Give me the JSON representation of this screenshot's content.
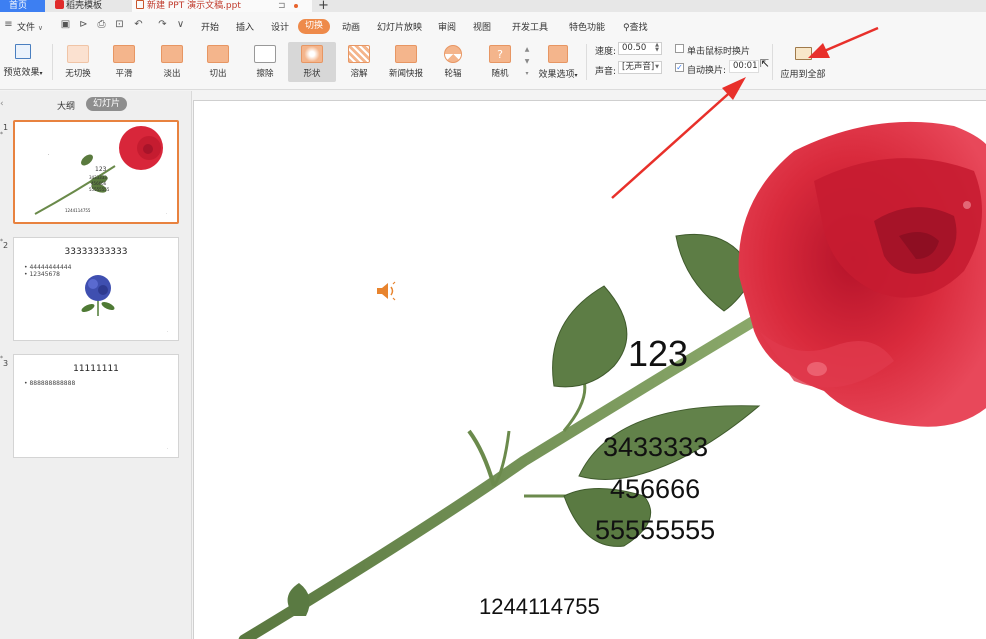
{
  "tabs": {
    "home": "首页",
    "template": "稻壳模板",
    "document": "新建 PPT 演示文稿.ppt"
  },
  "menu": {
    "file": "文件",
    "items": [
      "开始",
      "插入",
      "设计",
      "切换",
      "动画",
      "幻灯片放映",
      "审阅",
      "视图",
      "开发工具",
      "特色功能"
    ],
    "active": "切换",
    "search": "查找"
  },
  "ribbon": {
    "preview": "预览效果",
    "transitions": [
      {
        "label": "无切换"
      },
      {
        "label": "平滑"
      },
      {
        "label": "淡出"
      },
      {
        "label": "切出"
      },
      {
        "label": "擦除"
      },
      {
        "label": "形状",
        "selected": true
      },
      {
        "label": "溶解"
      },
      {
        "label": "新闻快报"
      },
      {
        "label": "轮辐"
      },
      {
        "label": "随机"
      }
    ],
    "effect_options": "效果选项",
    "speed_label": "速度:",
    "speed_value": "00.50",
    "sound_label": "声音:",
    "sound_value": "[无声音]",
    "click_advance": "单击鼠标时换片",
    "auto_advance": "自动换片:",
    "auto_advance_value": "00:01",
    "apply_all": "应用到全部"
  },
  "panel": {
    "outline": "大纲",
    "slides_tab": "幻灯片",
    "slides": [
      {
        "num": "1",
        "lines": [
          "123",
          "3433333",
          "456666",
          "55555555",
          "1244114755"
        ]
      },
      {
        "num": "2",
        "title": "33333333333",
        "bullets": [
          "44444444444",
          "12345678"
        ]
      },
      {
        "num": "3",
        "title": "11111111",
        "bullets": [
          "888888888888"
        ]
      }
    ]
  },
  "slide": {
    "texts": [
      "123",
      "3433333",
      "456666",
      "55555555",
      "1244114755"
    ]
  },
  "colors": {
    "accent": "#ee8a4a",
    "home_tab": "#3d7ff2",
    "annotation": "#e8302a"
  }
}
